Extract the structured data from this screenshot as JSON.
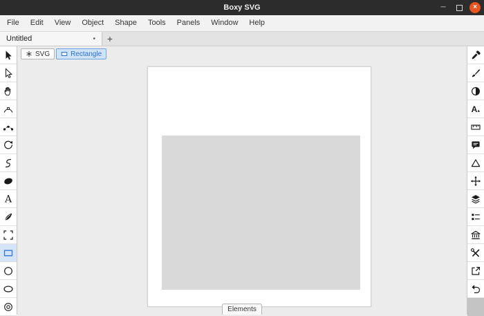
{
  "window": {
    "title": "Boxy SVG",
    "controls": {
      "minimize_glyph": "─",
      "close_glyph": "×"
    }
  },
  "menubar": {
    "items": [
      "File",
      "Edit",
      "View",
      "Object",
      "Shape",
      "Tools",
      "Panels",
      "Window",
      "Help"
    ]
  },
  "tabbar": {
    "tab_label": "Untitled",
    "modified_indicator": "•",
    "new_tab_label": "+"
  },
  "breadcrumb": {
    "svg_label": "SVG",
    "rectangle_label": "Rectangle",
    "selected": "Rectangle"
  },
  "left_toolbar": {
    "tools": [
      {
        "name": "transform-tool",
        "selected": false
      },
      {
        "name": "edit-tool",
        "selected": false
      },
      {
        "name": "pan-tool",
        "selected": false
      },
      {
        "name": "point-transform-tool",
        "selected": false
      },
      {
        "name": "edit-points-tool",
        "selected": false
      },
      {
        "name": "rotate-tool",
        "selected": false
      },
      {
        "name": "spiral-tool",
        "selected": false
      },
      {
        "name": "blob-tool",
        "selected": false
      },
      {
        "name": "text-tool",
        "selected": false
      },
      {
        "name": "pen-tool",
        "selected": false
      },
      {
        "name": "view-tool",
        "selected": false
      },
      {
        "name": "rect-tool",
        "selected": true
      },
      {
        "name": "circle-tool",
        "selected": false
      },
      {
        "name": "ellipse-tool",
        "selected": false
      },
      {
        "name": "shapes-tool",
        "selected": false
      }
    ],
    "text_tool_glyph": "A"
  },
  "right_toolbar": {
    "panels": [
      {
        "name": "fill-panel"
      },
      {
        "name": "stroke-panel"
      },
      {
        "name": "compositing-panel"
      },
      {
        "name": "typography-panel"
      },
      {
        "name": "geometry-panel"
      },
      {
        "name": "meta-panel"
      },
      {
        "name": "shape-panel"
      },
      {
        "name": "arrangement-panel"
      },
      {
        "name": "objects-panel"
      },
      {
        "name": "elements-panel"
      },
      {
        "name": "library-panel"
      },
      {
        "name": "tools-panel"
      },
      {
        "name": "export-panel"
      },
      {
        "name": "history-panel"
      }
    ],
    "typography_glyph": "A"
  },
  "canvas": {
    "page": {
      "fill": "#ffffff"
    },
    "shape": {
      "type": "rect",
      "fill": "#d9d9d9"
    }
  },
  "statusbar": {
    "elements_label": "Elements"
  },
  "colors": {
    "titlebar_bg": "#2c2c2c",
    "menubar_bg": "#f2f2f2",
    "tabbar_bg": "#e3e3e3",
    "canvas_bg": "#ececec",
    "page_fill": "#ffffff",
    "shape_fill": "#d9d9d9",
    "accent_blue": "#2f6fd0",
    "selected_tool_bg": "#d5e5f7",
    "close_button": "#e95420"
  }
}
